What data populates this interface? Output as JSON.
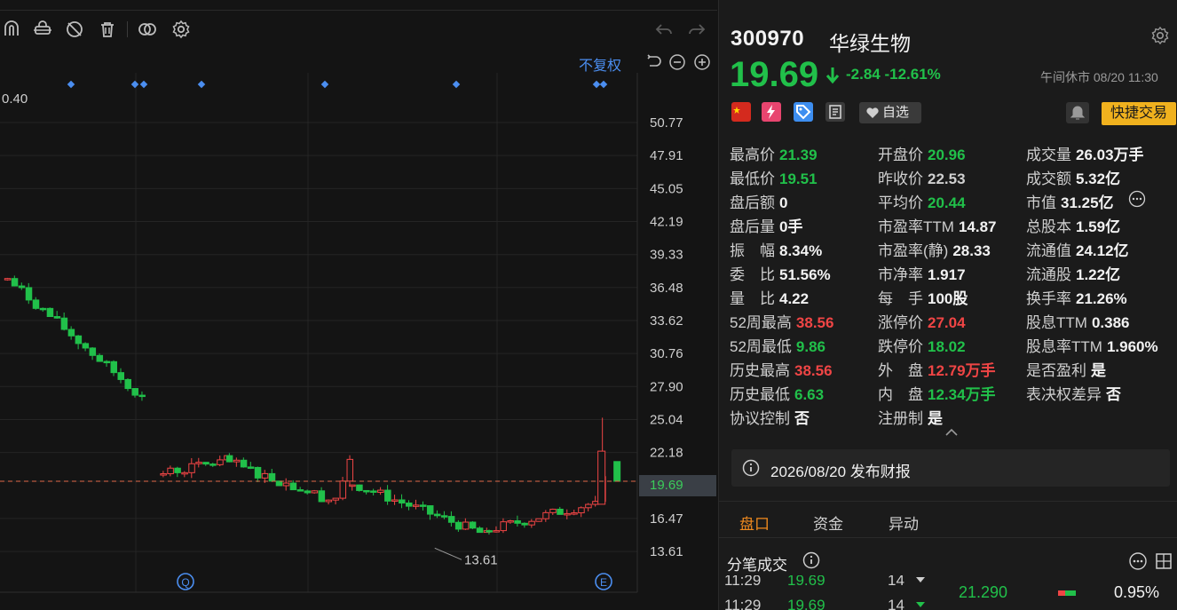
{
  "chart": {
    "adjust_label": "不复权",
    "left_label": "0.40",
    "y_axis": [
      "50.77",
      "47.91",
      "45.05",
      "42.19",
      "39.33",
      "36.48",
      "33.62",
      "30.76",
      "27.90",
      "25.04",
      "22.18",
      "19.69",
      "16.47",
      "13.61"
    ],
    "current_price_tag": "19.69",
    "low_annotation": "13.61",
    "markers": [
      {
        "label": "Q",
        "icon": "quarter-report-marker"
      },
      {
        "label": "E",
        "icon": "earnings-marker"
      }
    ],
    "colors": {
      "up": "#f04545",
      "down": "#21c04a",
      "marker": "#4b8ef0"
    }
  },
  "chart_data": {
    "type": "candlestick",
    "ylim": [
      12.0,
      52.0
    ],
    "y_ticks": [
      50.77,
      47.91,
      45.05,
      42.19,
      39.33,
      36.48,
      33.62,
      30.76,
      27.9,
      25.04,
      22.18,
      19.69,
      16.47,
      13.61
    ],
    "reference_price": 19.69,
    "period_low": 13.61,
    "segments": [
      {
        "start": 2,
        "end": 60,
        "from": 37.2,
        "to": 26.8
      },
      {
        "start": 68,
        "end": 95,
        "from": 20.4,
        "to": 21.5
      },
      {
        "start": 96,
        "end": 140,
        "from": 21.3,
        "to": 18.0
      },
      {
        "start": 141,
        "end": 147,
        "from": 18.3,
        "to": 21.2
      },
      {
        "start": 148,
        "end": 205,
        "from": 19.5,
        "to": 15.0
      },
      {
        "start": 206,
        "end": 250,
        "from": 15.5,
        "to": 17.8
      },
      {
        "start": 251,
        "end": 254,
        "from": 17.6,
        "to": 19.69
      }
    ]
  },
  "quote": {
    "code": "300970",
    "name": "华绿生物",
    "price": "19.69",
    "change": "-2.84 -12.61%",
    "status_time": "午间休市 08/20 11:30",
    "watch_label": "自选",
    "quick_trade": "快捷交易"
  },
  "stats": [
    [
      {
        "l": "最高价",
        "v": "21.39",
        "c": "green"
      },
      {
        "l": "开盘价",
        "v": "20.96",
        "c": "green"
      },
      {
        "l": "成交量",
        "v": "26.03万手",
        "c": "white"
      }
    ],
    [
      {
        "l": "最低价",
        "v": "19.51",
        "c": "green"
      },
      {
        "l": "昨收价",
        "v": "22.53",
        "c": "grey"
      },
      {
        "l": "成交额",
        "v": "5.32亿",
        "c": "white"
      }
    ],
    [
      {
        "l": "盘后额",
        "v": "0",
        "c": "white"
      },
      {
        "l": "平均价",
        "v": "20.44",
        "c": "green"
      },
      {
        "l": "市值",
        "v": "31.25亿",
        "c": "white"
      }
    ],
    [
      {
        "l": "盘后量",
        "v": "0手",
        "c": "white"
      },
      {
        "l": "市盈率TTM",
        "v": "14.87",
        "c": "white"
      },
      {
        "l": "总股本",
        "v": "1.59亿",
        "c": "white"
      }
    ],
    [
      {
        "l": "振　幅",
        "v": "8.34%",
        "c": "white"
      },
      {
        "l": "市盈率(静)",
        "v": "28.33",
        "c": "white"
      },
      {
        "l": "流通值",
        "v": "24.12亿",
        "c": "white"
      }
    ],
    [
      {
        "l": "委　比",
        "v": "51.56%",
        "c": "white"
      },
      {
        "l": "市净率",
        "v": "1.917",
        "c": "white"
      },
      {
        "l": "流通股",
        "v": "1.22亿",
        "c": "white"
      }
    ],
    [
      {
        "l": "量　比",
        "v": "4.22",
        "c": "white"
      },
      {
        "l": "每　手",
        "v": "100股",
        "c": "white"
      },
      {
        "l": "换手率",
        "v": "21.26%",
        "c": "white"
      }
    ],
    [
      {
        "l": "52周最高",
        "v": "38.56",
        "c": "red"
      },
      {
        "l": "涨停价",
        "v": "27.04",
        "c": "red"
      },
      {
        "l": "股息TTM",
        "v": "0.386",
        "c": "white"
      }
    ],
    [
      {
        "l": "52周最低",
        "v": "9.86",
        "c": "green"
      },
      {
        "l": "跌停价",
        "v": "18.02",
        "c": "green"
      },
      {
        "l": "股息率TTM",
        "v": "1.960%",
        "c": "white"
      }
    ],
    [
      {
        "l": "历史最高",
        "v": "38.56",
        "c": "red"
      },
      {
        "l": "外　盘",
        "v": "12.79万手",
        "c": "red"
      },
      {
        "l": "是否盈利",
        "v": "是",
        "c": "white"
      }
    ],
    [
      {
        "l": "历史最低",
        "v": "6.63",
        "c": "green"
      },
      {
        "l": "内　盘",
        "v": "12.34万手",
        "c": "green"
      },
      {
        "l": "表决权差异",
        "v": "否",
        "c": "white"
      }
    ],
    [
      {
        "l": "协议控制",
        "v": "否",
        "c": "white"
      },
      {
        "l": "注册制",
        "v": "是",
        "c": "white"
      },
      null
    ]
  ],
  "report": {
    "text": "2026/08/20  发布财报"
  },
  "tabs": [
    {
      "label": "盘口",
      "active": true
    },
    {
      "label": "资金",
      "active": false
    },
    {
      "label": "异动",
      "active": false
    }
  ],
  "ticks": {
    "title": "分笔成交",
    "rows": [
      {
        "time": "11:29",
        "price": "19.69",
        "vol": "14",
        "dir": "down"
      },
      {
        "time": "11:29",
        "price": "19.69",
        "vol": "14",
        "dir": "down"
      }
    ],
    "side_quote": "21.290",
    "side_pct": "0.95%"
  }
}
